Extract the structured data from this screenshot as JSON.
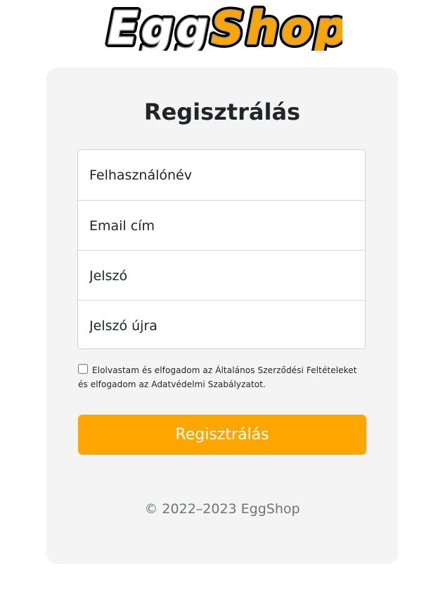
{
  "logo": {
    "text_part1": "Egg",
    "text_part2": "Shop",
    "color_part1": "#ffffff",
    "color_part2": "#ffa500"
  },
  "form": {
    "title": "Regisztrálás",
    "fields": [
      {
        "name": "username",
        "placeholder": "Felhasználónév",
        "value": ""
      },
      {
        "name": "email",
        "placeholder": "Email cím",
        "value": ""
      },
      {
        "name": "password",
        "placeholder": "Jelszó",
        "value": ""
      },
      {
        "name": "password_confirm",
        "placeholder": "Jelszó újra",
        "value": ""
      }
    ],
    "terms_text": "Elolvastam és elfogadom az Általános Szerződési Feltételeket és elfogadom az Adatvédelmi Szabályzatot.",
    "terms_checked": false,
    "submit_label": "Regisztrálás"
  },
  "footer": {
    "copyright": "© 2022–2023 EggShop"
  },
  "colors": {
    "accent": "#ffa500",
    "card_background": "#f4f4f4"
  }
}
